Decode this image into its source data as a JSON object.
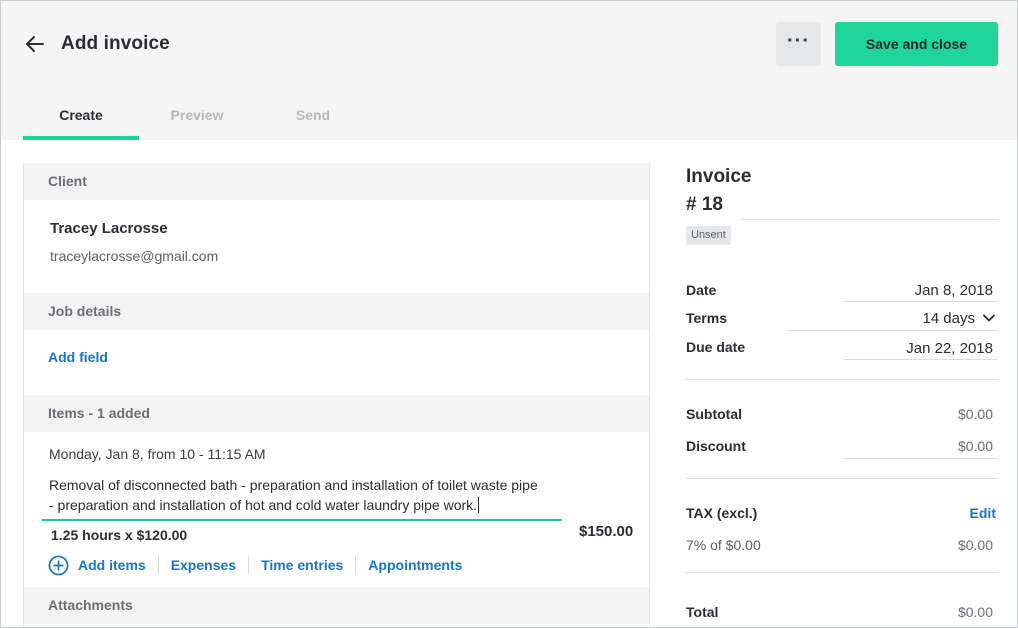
{
  "header": {
    "title": "Add invoice",
    "more_label": "···",
    "save_label": "Save and close",
    "accent_color": "#1ed69a"
  },
  "tabs": [
    {
      "label": "Create",
      "active": true
    },
    {
      "label": "Preview",
      "active": false
    },
    {
      "label": "Send",
      "active": false
    }
  ],
  "client": {
    "section_label": "Client",
    "name": "Tracey Lacrosse",
    "email": "traceylacrosse@gmail.com"
  },
  "job_details": {
    "section_label": "Job details",
    "add_field_label": "Add field"
  },
  "items": {
    "section_label": "Items - 1 added",
    "entry": {
      "date_line": "Monday, Jan 8, from 10 - 11:15 AM",
      "description_line1": "Removal of disconnected bath - preparation and installation of toilet waste pipe",
      "description_line2": "- preparation and installation of hot and cold water laundry pipe work.",
      "quantity_line": "1.25 hours x $120.00",
      "total": "$150.00"
    },
    "links": {
      "add_items": "Add items",
      "expenses": "Expenses",
      "time_entries": "Time entries",
      "appointments": "Appointments"
    }
  },
  "attachments": {
    "section_label": "Attachments"
  },
  "invoice": {
    "title": "Invoice",
    "number": "# 18",
    "status": "Unsent",
    "date_label": "Date",
    "date_value": "Jan 8, 2018",
    "terms_label": "Terms",
    "terms_value": "14 days",
    "due_label": "Due date",
    "due_value": "Jan 22, 2018",
    "subtotal_label": "Subtotal",
    "subtotal_value": "$0.00",
    "discount_label": "Discount",
    "discount_value": "$0.00",
    "tax_label": "TAX (excl.)",
    "tax_edit": "Edit",
    "tax_rate_line": "7% of $0.00",
    "tax_value": "$0.00",
    "total_label": "Total",
    "total_value": "$0.00"
  },
  "icons": {
    "back": "arrow-left-icon",
    "add": "plus-circle-icon",
    "terms_dropdown": "chevron-down-icon"
  }
}
